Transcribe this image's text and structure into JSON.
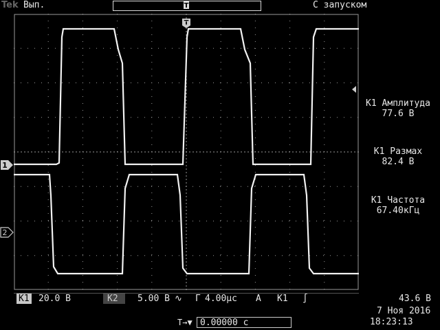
{
  "header": {
    "logo": "Tek",
    "acq_state": "Вып.",
    "trigger_status": "С запуском"
  },
  "channels": {
    "ch1_marker": "1",
    "ch2_marker": "2",
    "trigger_marker": "T"
  },
  "measurements": [
    {
      "label": "К1 Амплитуда",
      "value": "77.6 В"
    },
    {
      "label": "К1 Размах",
      "value": "82.4 В"
    },
    {
      "label": "К1 Частота",
      "value": "67.40кГц"
    }
  ],
  "status": {
    "ch1_label": "К1",
    "ch1_scale": "20.0 В",
    "ch2_label": "К2",
    "ch2_scale": "5.00 В",
    "bandwidth_symbol": "∿",
    "time_label": "Г",
    "time_scale": "4.00μс",
    "trig_mode_label": "А",
    "trig_source": "К1",
    "trig_slope_symbol": "∫",
    "trig_level": "43.6 В",
    "trig_position": "0.00000 с",
    "trig_pos_icon": "T→▼"
  },
  "datetime": {
    "date": "7 Ноя 2016",
    "time": "18:23:13"
  },
  "colors": {
    "trace": "#f2f2f2",
    "grid": "#9a9a9a",
    "background": "#000000"
  }
}
